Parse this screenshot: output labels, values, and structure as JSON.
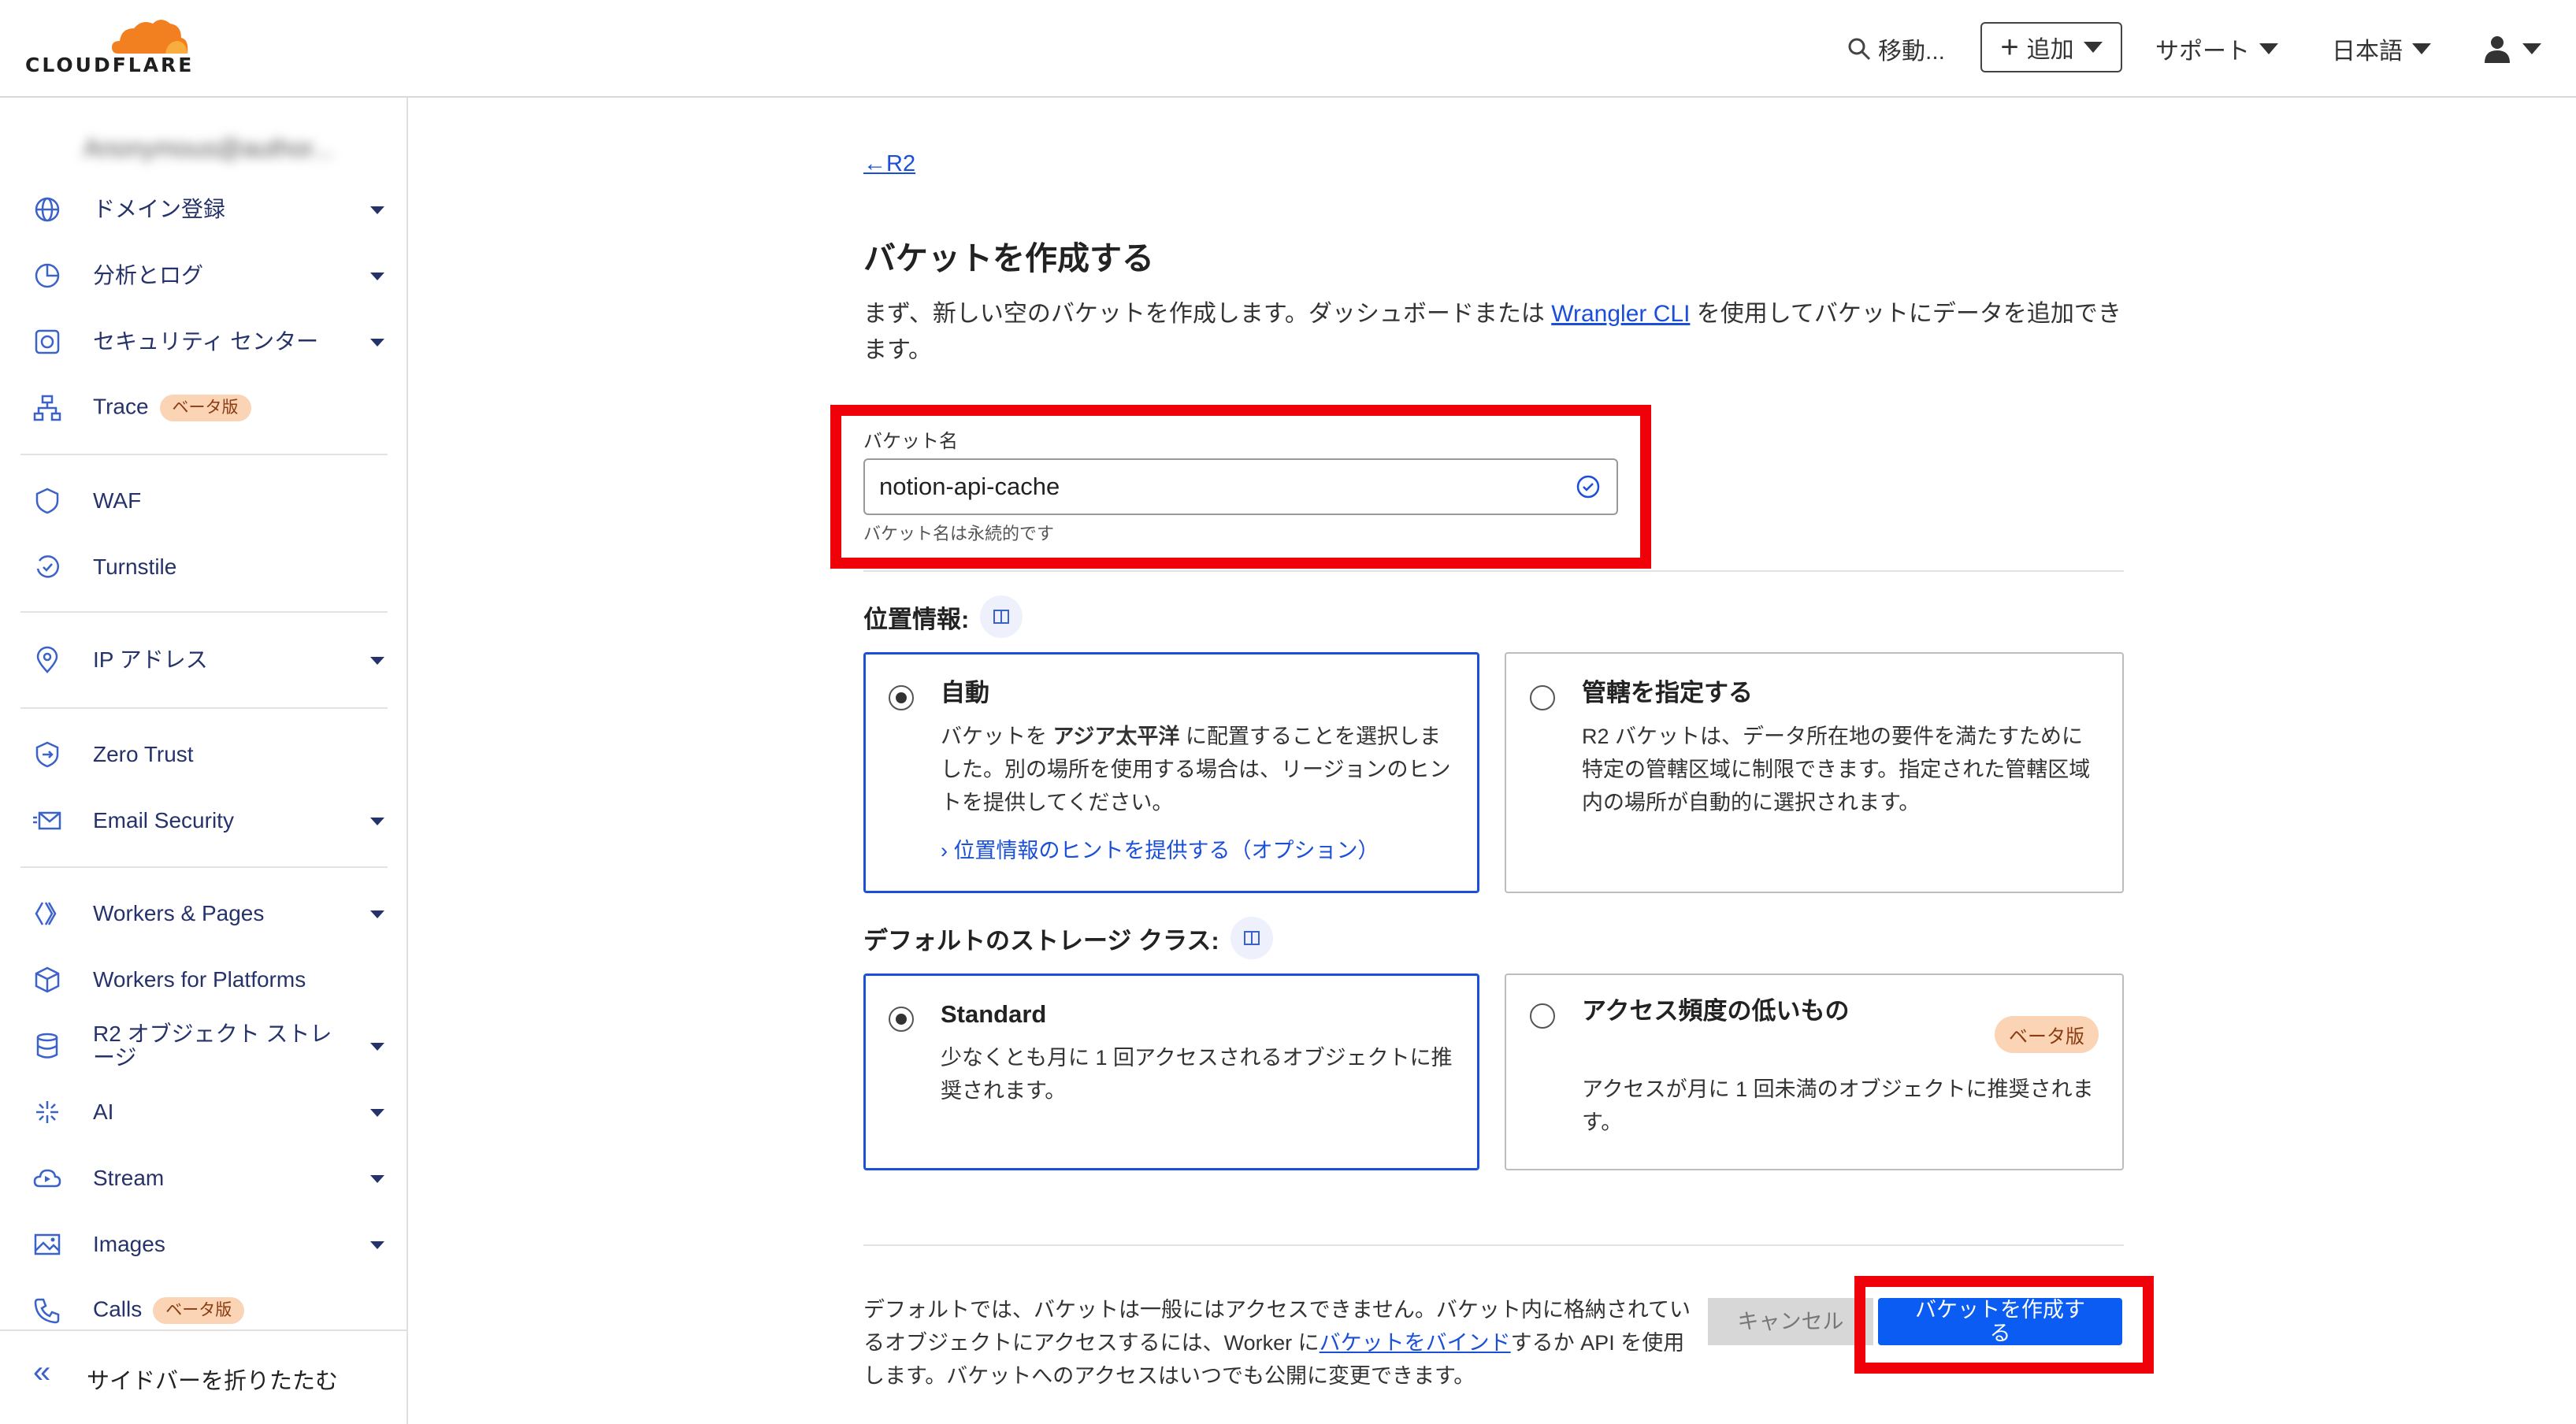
{
  "header": {
    "logo_text": "CLOUDFLARE",
    "search_label": "移動...",
    "add_label": "追加",
    "support_label": "サポート",
    "language_label": "日本語"
  },
  "sidebar": {
    "account_name": "Anonymous@author...",
    "items": [
      {
        "label": "ドメイン登録",
        "icon": "globe-icon"
      },
      {
        "label": "分析とログ",
        "icon": "pie-chart-icon"
      },
      {
        "label": "セキュリティ センター",
        "icon": "security-center-icon"
      },
      {
        "label": "Trace",
        "icon": "trace-icon",
        "badge": "ベータ版"
      },
      {
        "label": "WAF",
        "icon": "waf-shield-icon"
      },
      {
        "label": "Turnstile",
        "icon": "turnstile-icon"
      },
      {
        "label": "IP アドレス",
        "icon": "location-pin-icon"
      },
      {
        "label": "Zero Trust",
        "icon": "zero-trust-icon"
      },
      {
        "label": "Email Security",
        "icon": "email-icon"
      },
      {
        "label": "Workers & Pages",
        "icon": "workers-icon"
      },
      {
        "label": "Workers for Platforms",
        "icon": "cube-icon"
      },
      {
        "label": "R2 オブジェクト ストレージ",
        "icon": "database-icon"
      },
      {
        "label": "AI",
        "icon": "sparkle-icon"
      },
      {
        "label": "Stream",
        "icon": "stream-icon"
      },
      {
        "label": "Images",
        "icon": "image-icon"
      },
      {
        "label": "Calls",
        "icon": "phone-icon",
        "badge": "ベータ版"
      }
    ],
    "collapse_label": "サイドバーを折りたたむ"
  },
  "main": {
    "back_label": "R2",
    "title": "バケットを作成する",
    "desc_before": "まず、新しい空のバケットを作成します。ダッシュボードまたは ",
    "desc_link": "Wrangler CLI",
    "desc_after": " を使用してバケットにデータを追加できます。",
    "bucket_name_label": "バケット名",
    "bucket_name_value": "notion-api-cache",
    "bucket_name_help": "バケット名は永続的です",
    "location": {
      "title": "位置情報:",
      "auto_title": "自動",
      "auto_text_1": "バケットを ",
      "auto_text_bold": "アジア太平洋",
      "auto_text_2": " に配置することを選択しました。別の場所を使用する場合は、リージョンのヒントを提供してください。",
      "auto_link": "位置情報のヒントを提供する（オプション）",
      "jur_title": "管轄を指定する",
      "jur_text": "R2 バケットは、データ所在地の要件を満たすために特定の管轄区域に制限できます。指定された管轄区域内の場所が自動的に選択されます。"
    },
    "storage": {
      "title": "デフォルトのストレージ クラス:",
      "std_title": "Standard",
      "std_text": "少なくとも月に 1 回アクセスされるオブジェクトに推奨されます。",
      "ia_title": "アクセス頻度の低いもの",
      "ia_badge": "ベータ版",
      "ia_text": "アクセスが月に 1 回未満のオブジェクトに推奨されます。"
    },
    "footer_before": "デフォルトでは、バケットは一般にはアクセスできません。バケット内に格納されているオブジェクトにアクセスするには、Worker に",
    "footer_link": "バケットをバインド",
    "footer_after": "するか API を使用します。バケットへのアクセスはいつでも公開に変更できます。",
    "cancel_label": "キャンセル",
    "create_label": "バケットを作成する"
  }
}
